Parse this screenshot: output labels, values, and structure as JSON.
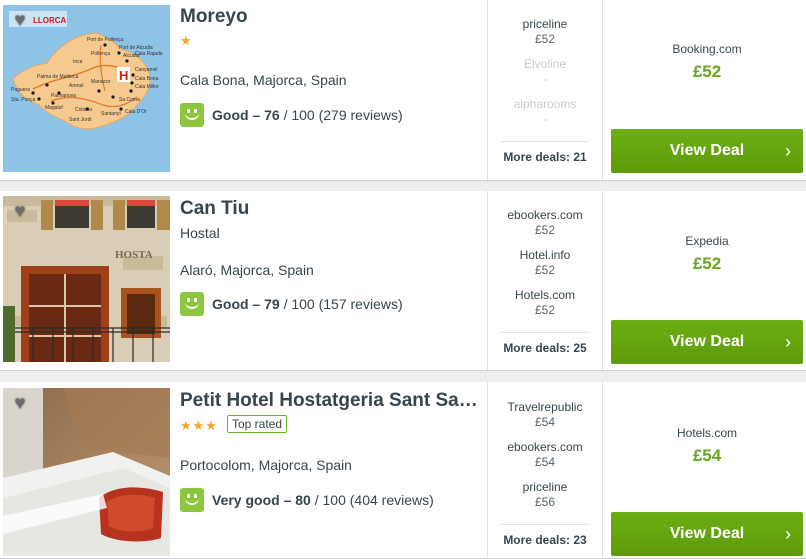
{
  "hotels": [
    {
      "name": "Moreyo",
      "stars": "★",
      "location": "Cala Bona, Majorca, Spain",
      "rating_word": "Good – 76",
      "rating_rest": " / 100 (279 reviews)",
      "map": {
        "title": "LLORCA",
        "places": [
          "Port de Pollença",
          "Port de Alcudia",
          "Pollença",
          "Alcudia",
          "Cala Rajada",
          "Canyamel",
          "Cala Bona",
          "Cala Millor",
          "Manacor",
          "Palma de Mallorca",
          "Paguera",
          "Sta. Ponça",
          "Palmanova",
          "Magaluf",
          "Colonia",
          "Santanyí",
          "Sa Coma",
          "Cala D'Or",
          "Sant Jordi",
          "Arenal",
          "Inca"
        ]
      },
      "others": [
        {
          "site": "priceline",
          "price": "£52"
        },
        {
          "site": "Elvoline",
          "price": "-"
        },
        {
          "site": "alpharooms",
          "price": "-"
        }
      ],
      "more_deals": "More deals: 21",
      "best_site": "Booking.com",
      "best_price": "£52",
      "cta": "View Deal"
    },
    {
      "name": "Can Tiu",
      "subtype": "Hostal",
      "location": "Alaró, Majorca, Spain",
      "rating_word": "Good – 79",
      "rating_rest": " / 100 (157 reviews)",
      "photo_sign": "HOSTA",
      "others": [
        {
          "site": "ebookers.com",
          "price": "£52"
        },
        {
          "site": "Hotel.info",
          "price": "£52"
        },
        {
          "site": "Hotels.com",
          "price": "£52"
        }
      ],
      "more_deals": "More deals: 25",
      "best_site": "Expedia",
      "best_price": "£52",
      "cta": "View Deal"
    },
    {
      "name": "Petit Hotel Hostatgeria Sant Salvador",
      "stars": "★★★",
      "badge": "Top rated",
      "location": "Portocolom, Majorca, Spain",
      "rating_word": "Very good – 80",
      "rating_rest": " / 100 (404 reviews)",
      "others": [
        {
          "site": "Travelrepublic",
          "price": "£54"
        },
        {
          "site": "ebookers.com",
          "price": "£54"
        },
        {
          "site": "priceline",
          "price": "£56"
        }
      ],
      "more_deals": "More deals: 23",
      "best_site": "Hotels.com",
      "best_price": "£54",
      "cta": "View Deal"
    }
  ],
  "colors": {
    "accent_green": "#65a30d",
    "price_green": "#6aa621",
    "rating_green": "#8cc63f",
    "star_orange": "#f5a623"
  },
  "icons": {
    "favorite": "heart-icon",
    "rating": "smiley-icon",
    "button": "chevron-right-icon"
  }
}
